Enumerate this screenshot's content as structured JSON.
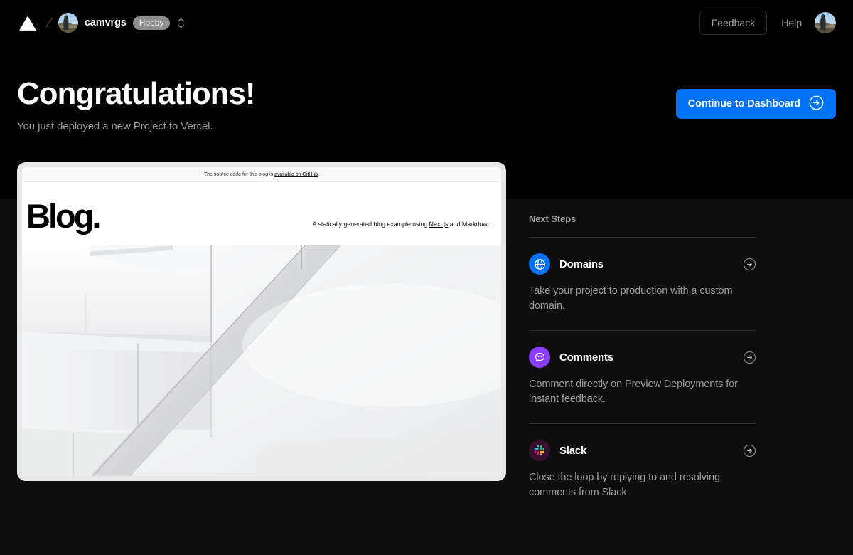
{
  "header": {
    "logo_icon": "vercel-triangle-logo",
    "breadcrumb_separator": "/",
    "team_name": "camvrgs",
    "plan_badge": "Hobby",
    "scope_selector_icon": "chevron-up-down-icon",
    "feedback_label": "Feedback",
    "help_label": "Help",
    "user_avatar_icon": "user-avatar"
  },
  "hero": {
    "title": "Congratulations!",
    "subtitle": "You just deployed a new Project to Vercel.",
    "cta_label": "Continue to Dashboard",
    "cta_icon": "arrow-right-circle-icon",
    "cta_color": "#0072f5"
  },
  "preview": {
    "topbar_prefix": "The source code for this blog is ",
    "topbar_link": "available on GitHub",
    "topbar_suffix": ".",
    "blog_title": "Blog.",
    "tagline_prefix": "A statically generated blog example using ",
    "tagline_link": "Next.js",
    "tagline_suffix": " and Markdown.",
    "hero_image": "abstract-white-architecture-photo"
  },
  "next_steps": {
    "title": "Next Steps",
    "items": [
      {
        "label": "Domains",
        "description": "Take your project to production with a custom domain.",
        "icon": "globe-icon",
        "icon_bg": "#0072f5",
        "arrow_icon": "arrow-right-circle-icon"
      },
      {
        "label": "Comments",
        "description": "Comment directly on Preview Deployments for instant feedback.",
        "icon": "comment-bubble-icon",
        "icon_bg": "#8b3dff",
        "arrow_icon": "arrow-right-circle-icon"
      },
      {
        "label": "Slack",
        "description": "Close the loop by replying to and resolving comments from Slack.",
        "icon": "slack-logo-icon",
        "icon_bg": "#36102e",
        "arrow_icon": "arrow-right-circle-icon"
      }
    ]
  }
}
